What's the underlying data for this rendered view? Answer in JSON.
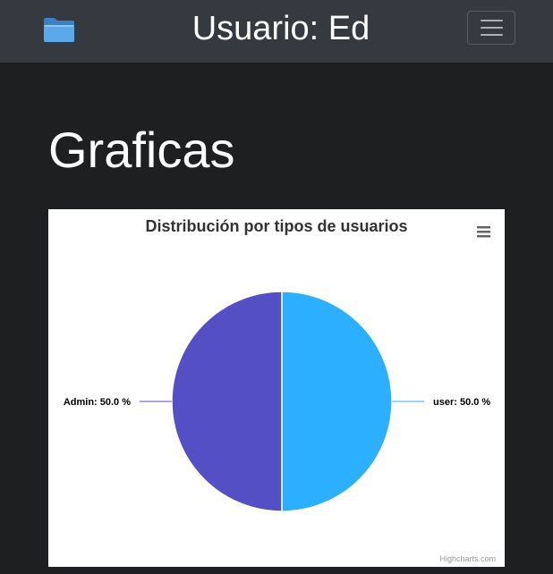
{
  "navbar": {
    "title": "Usuario: Ed",
    "folder_icon": "folder-icon",
    "menu_icon": "hamburger-menu-icon"
  },
  "page": {
    "heading": "Graficas"
  },
  "chart_data": {
    "type": "pie",
    "title": "Distribución por tipos de usuarios",
    "slices": [
      {
        "name": "user",
        "value": 50.0,
        "label": "user: 50.0 %",
        "color": "#2caffe"
      },
      {
        "name": "Admin",
        "value": 50.0,
        "label": "Admin: 50.0 %",
        "color": "#544fc5"
      }
    ],
    "legend": "none",
    "credits": "Highcharts.com",
    "menu_icon": "context-menu-icon"
  }
}
